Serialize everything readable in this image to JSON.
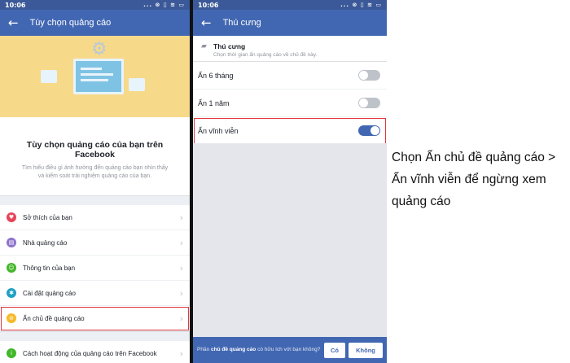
{
  "left": {
    "status": {
      "time": "10:06",
      "icons": "... ⊗ ▯ ≋ ▭"
    },
    "appbar": {
      "title": "Tùy chọn quảng cáo"
    },
    "promo": {
      "title": "Tùy chọn quảng cáo của bạn trên Facebook",
      "desc": "Tìm hiểu điều gì ảnh hưởng đến quảng cáo bạn nhìn thấy và kiểm soát trải nghiệm quảng cáo của bạn."
    },
    "menu": [
      {
        "label": "Sở thích của bạn",
        "icon": "heart-icon",
        "color": "#e9445a",
        "glyph": "♥"
      },
      {
        "label": "Nhà quảng cáo",
        "icon": "store-icon",
        "color": "#8c72cb",
        "glyph": "▤"
      },
      {
        "label": "Thông tin của bạn",
        "icon": "profile-icon",
        "color": "#42b72a",
        "glyph": "☺"
      },
      {
        "label": "Cài đặt quảng cáo",
        "icon": "settings-icon",
        "color": "#21a0c4",
        "glyph": "✱"
      },
      {
        "label": "Ẩn chủ đề quảng cáo",
        "icon": "hide-icon",
        "color": "#f7b928",
        "glyph": "⊘"
      },
      {
        "label": "Cách hoạt động của quảng cáo trên Facebook",
        "icon": "info-icon",
        "color": "#42b72a",
        "glyph": "i"
      }
    ]
  },
  "right": {
    "status": {
      "time": "10:06",
      "icons": "... ⊗ ▯ ≋ ▭"
    },
    "appbar": {
      "title": "Thú cưng"
    },
    "section": {
      "title": "Thú cưng",
      "desc": "Chọn thời gian ẩn quảng cáo về chủ đề này."
    },
    "options": [
      {
        "label": "Ẩn 6 tháng",
        "on": false
      },
      {
        "label": "Ẩn 1 năm",
        "on": false
      },
      {
        "label": "Ẩn vĩnh viễn",
        "on": true
      }
    ],
    "footer": {
      "prefix": "Phần ",
      "bold": "chủ đề quảng cáo",
      "suffix": " có hữu ích với bạn không?",
      "yes": "Có",
      "no": "Không"
    }
  },
  "caption": "Chọn Ẩn chủ đề quảng cáo > Ẩn vĩnh viễn để ngừng xem quảng cáo",
  "colors": {
    "fb_blue": "#4267b2",
    "highlight": "#e0393e"
  }
}
